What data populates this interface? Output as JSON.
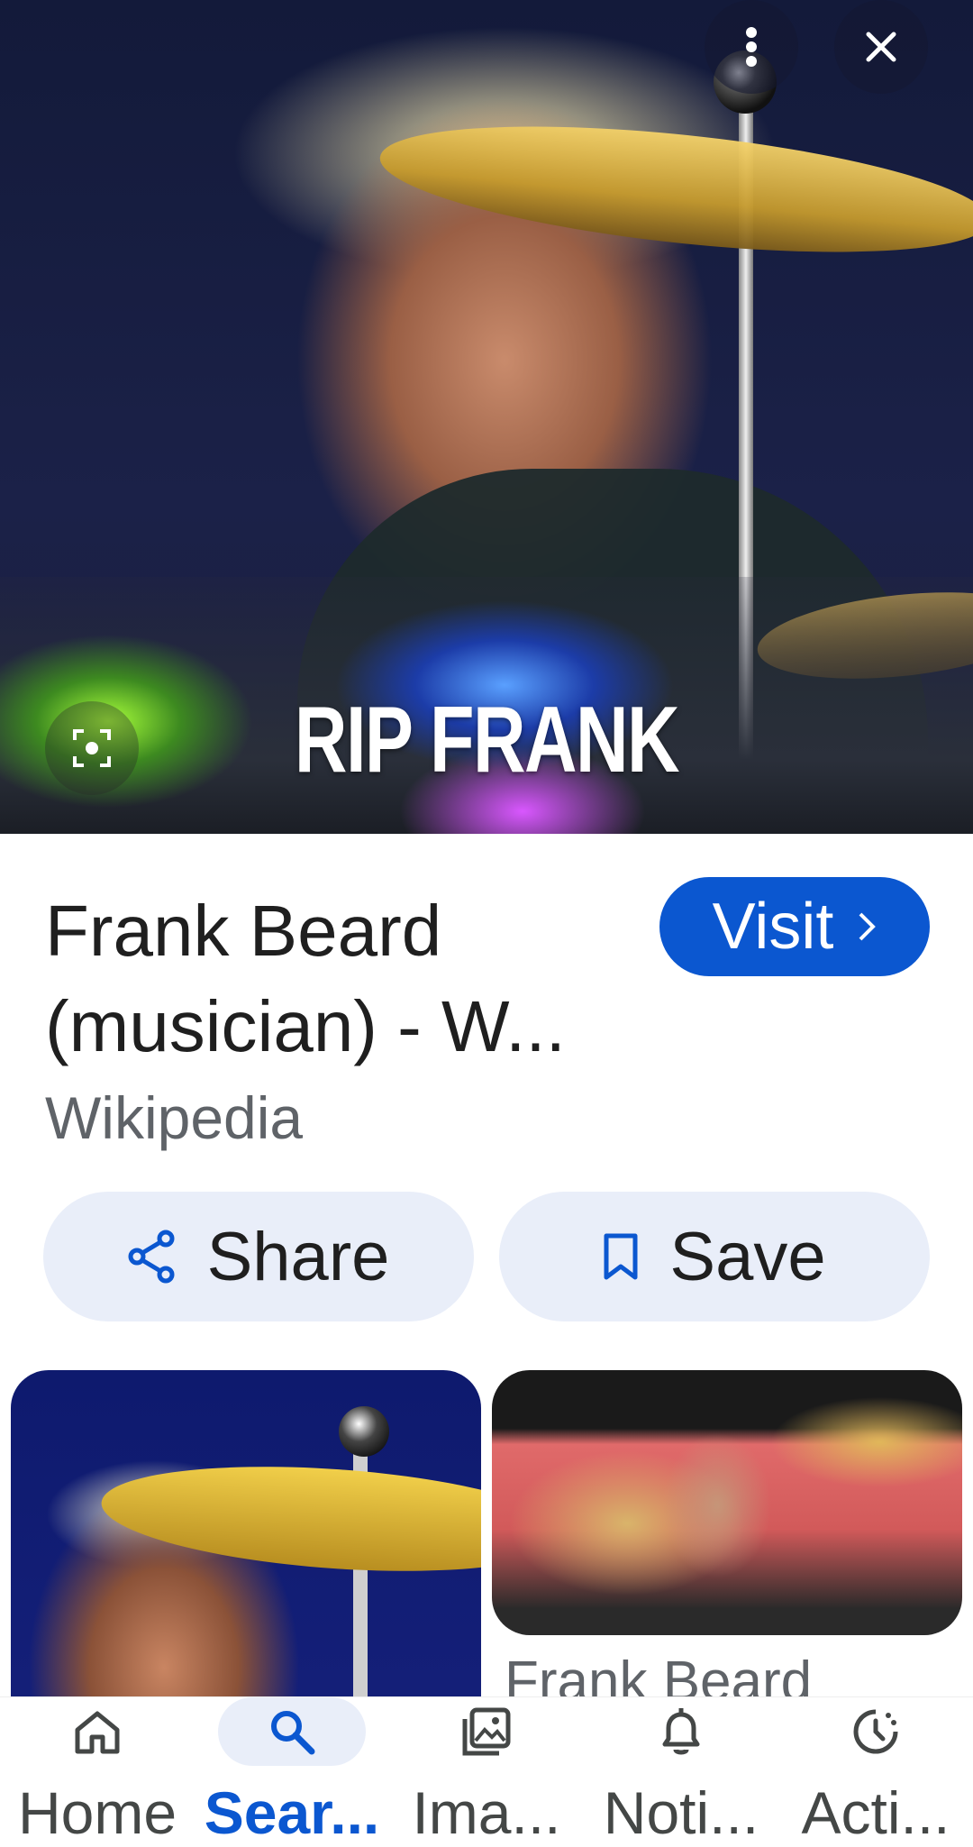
{
  "hero": {
    "caption": "RIP FRANK",
    "menu_icon": "more-vert-icon",
    "close_icon": "close-icon",
    "lens_icon": "lens-icon"
  },
  "result": {
    "title": "Frank Beard (musician) - W...",
    "source": "Wikipedia",
    "visit_label": "Visit",
    "share_label": "Share",
    "save_label": "Save"
  },
  "related": {
    "item2_title": "Frank Beard"
  },
  "bottom_nav": {
    "items": [
      {
        "label": "Home",
        "icon": "home-icon"
      },
      {
        "label": "Sear...",
        "icon": "search-icon"
      },
      {
        "label": "Ima...",
        "icon": "images-icon"
      },
      {
        "label": "Noti...",
        "icon": "bell-icon"
      },
      {
        "label": "Acti...",
        "icon": "activity-icon"
      }
    ],
    "active_index": 1
  },
  "colors": {
    "accent": "#0b57d0",
    "pill_bg": "#e9eef9",
    "secondary_text": "#5f6368"
  }
}
